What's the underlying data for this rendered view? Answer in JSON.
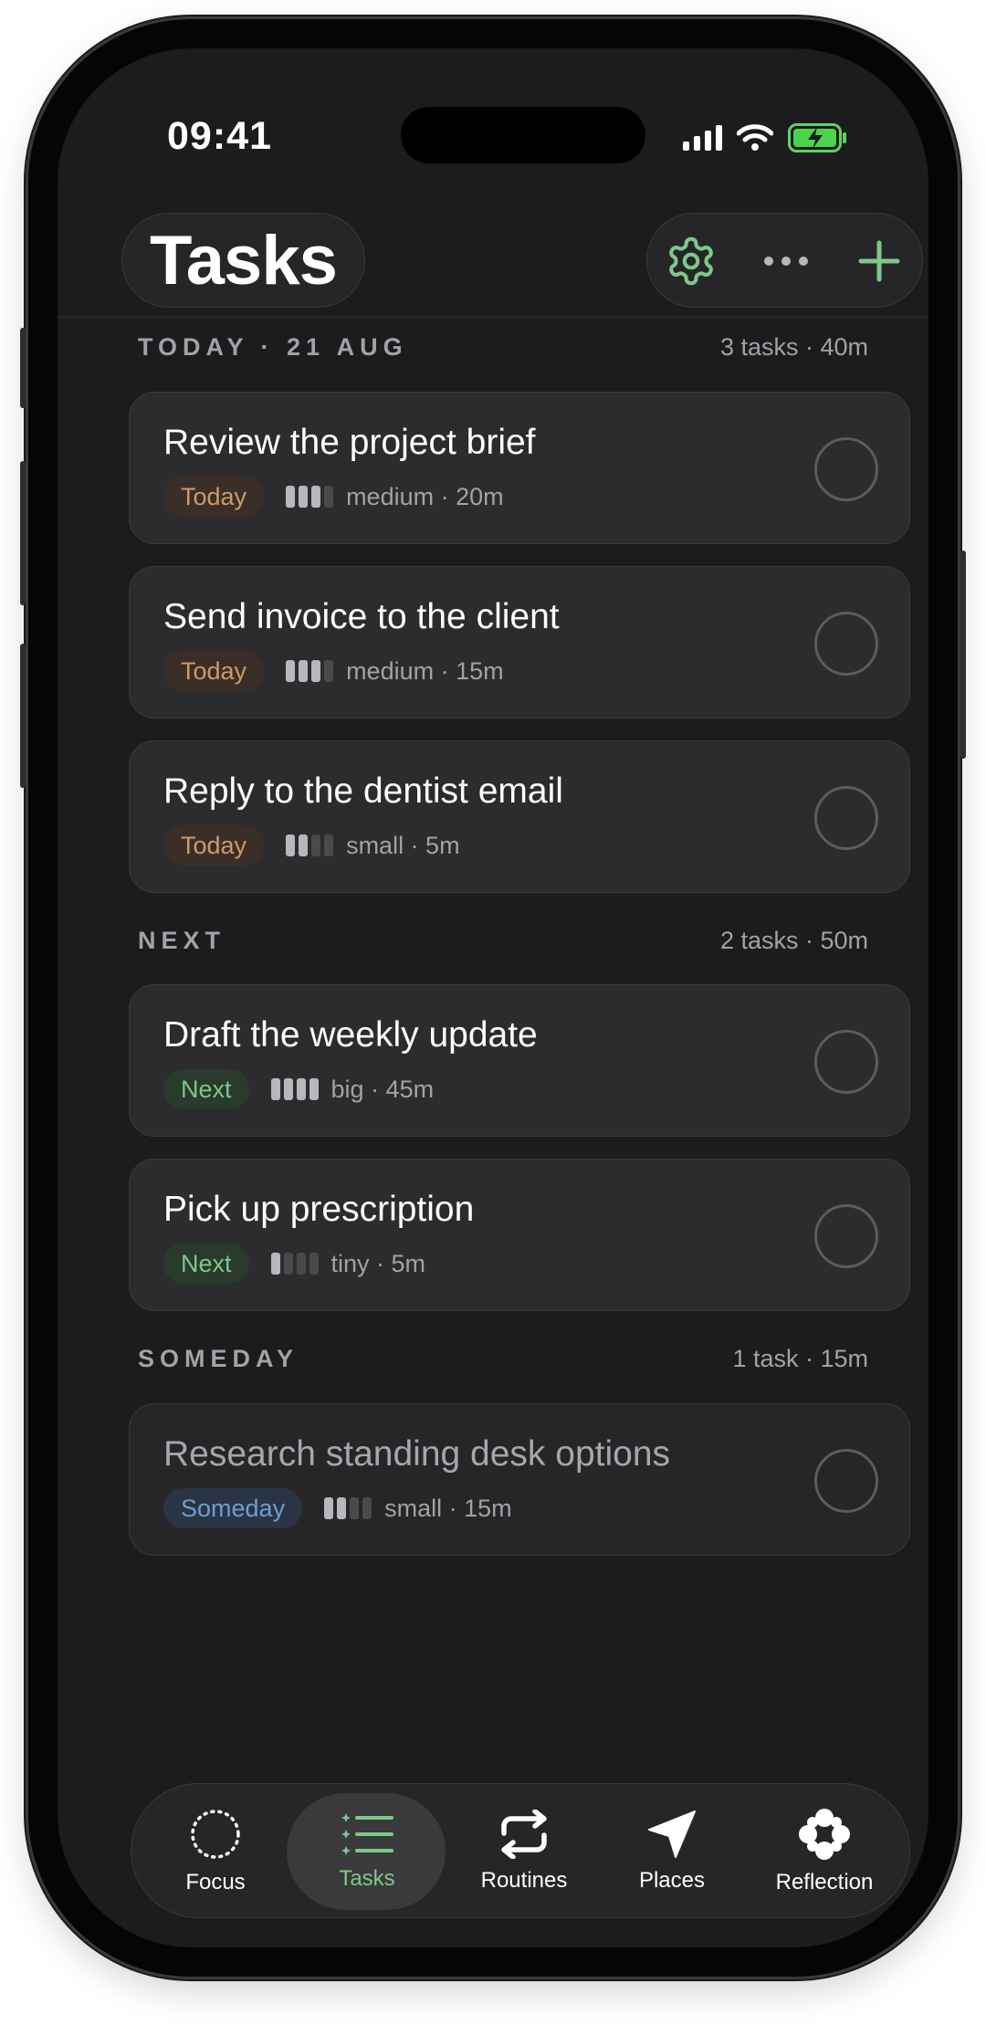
{
  "status_bar": {
    "time": "09:41"
  },
  "header": {
    "title": "Tasks",
    "icons": {
      "settings": "gear-icon",
      "more": "ellipsis-icon",
      "add": "plus-icon"
    }
  },
  "colors": {
    "accent": "#7dc88a",
    "today": "#d19a66",
    "someday": "#6f9dd1",
    "background": "#1c1c1e"
  },
  "sections": [
    {
      "title": "TODAY · 21 AUG",
      "summary": "3 tasks · 40m",
      "tasks": [
        {
          "title": "Review the project brief",
          "tag": "Today",
          "size": "medium · 20m",
          "effort_level": 3
        },
        {
          "title": "Send invoice to the client",
          "tag": "Today",
          "size": "medium · 15m",
          "effort_level": 3
        },
        {
          "title": "Reply to the dentist email",
          "tag": "Today",
          "size": "small · 5m",
          "effort_level": 2
        }
      ]
    },
    {
      "title": "NEXT",
      "summary": "2 tasks · 50m",
      "tasks": [
        {
          "title": "Draft the weekly update",
          "tag": "Next",
          "size": "big · 45m",
          "effort_level": 4
        },
        {
          "title": "Pick up prescription",
          "tag": "Next",
          "size": "tiny · 5m",
          "effort_level": 1
        }
      ]
    },
    {
      "title": "SOMEDAY",
      "summary": "1 task · 15m",
      "tasks": [
        {
          "title": "Research standing desk options",
          "tag": "Someday",
          "size": "small · 15m",
          "effort_level": 2
        }
      ]
    }
  ],
  "tabbar": {
    "items": [
      {
        "label": "Focus",
        "icon": "dotted-circle-icon"
      },
      {
        "label": "Tasks",
        "icon": "list-icon",
        "active": true
      },
      {
        "label": "Routines",
        "icon": "repeat-icon"
      },
      {
        "label": "Places",
        "icon": "location-arrow-icon"
      },
      {
        "label": "Reflection",
        "icon": "flower-icon"
      }
    ]
  }
}
